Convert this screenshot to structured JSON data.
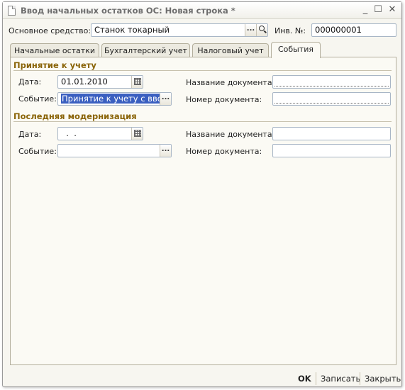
{
  "window": {
    "title": "Ввод начальных остатков ОС: Новая строка *",
    "minimize_symbol": "_",
    "maximize_symbol": "☐",
    "close_symbol": "✕"
  },
  "header": {
    "asset_label": "Основное средство:",
    "asset_value": "Станок токарный",
    "select_button": "...",
    "search_icon": "search-icon",
    "inv_label": "Инв. №:",
    "inv_value": "000000001"
  },
  "tabs": [
    {
      "label": "Начальные остатки",
      "active": false
    },
    {
      "label": "Бухгалтерский учет",
      "active": false
    },
    {
      "label": "Налоговый учет",
      "active": false
    },
    {
      "label": "События",
      "active": true
    }
  ],
  "acceptance": {
    "title": "Принятие к учету",
    "date_label": "Дата:",
    "date_value": "01.01.2010",
    "event_label": "Событие:",
    "event_value": "Принятие к учету с вводом",
    "event_button": "...",
    "doc_name_label": "Название документа:",
    "doc_name_value": "",
    "doc_number_label": "Номер документа:",
    "doc_number_value": ""
  },
  "modernization": {
    "title": "Последняя модернизация",
    "date_label": "Дата:",
    "date_value": "  .  .",
    "event_label": "Событие:",
    "event_value": "",
    "event_button": "...",
    "doc_name_label": "Название документа:",
    "doc_name_value": "",
    "doc_number_label": "Номер документа:",
    "doc_number_value": ""
  },
  "footer": {
    "ok_label": "OK",
    "save_label": "Записать",
    "close_label": "Закрыть"
  },
  "colors": {
    "group_title": "#8a6408",
    "selection": "#3a5fc0",
    "field_border": "#a8b6c6"
  }
}
